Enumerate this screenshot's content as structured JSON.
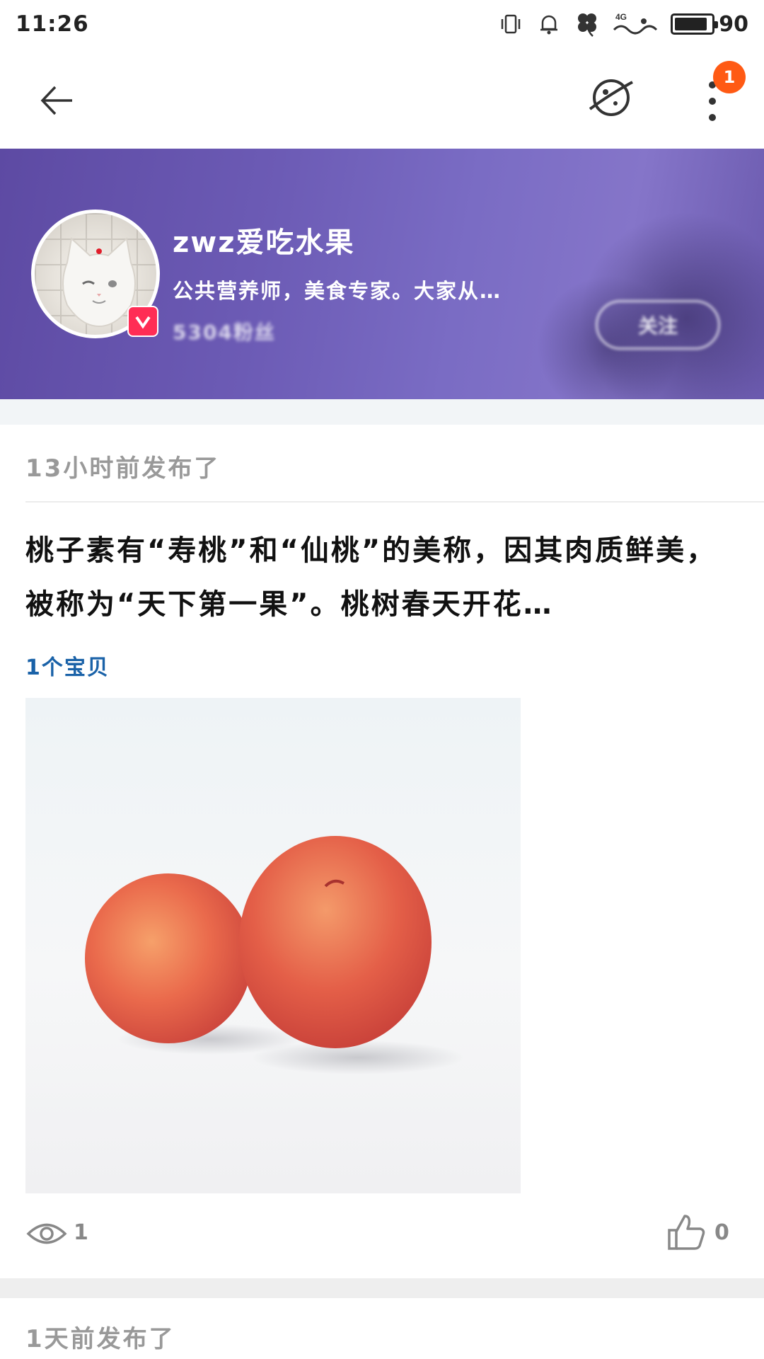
{
  "status_bar": {
    "time": "11:26",
    "network_label": "4G",
    "battery_level": "90"
  },
  "app_bar": {
    "notification_count": "1"
  },
  "profile": {
    "username": "zwz爱吃水果",
    "bio": "公共营养师，美食专家。大家从…",
    "verified": true
  },
  "posts": [
    {
      "time": "13小时前发布了",
      "text": "桃子素有“寿桃”和“仙桃”的美称，因其肉质鲜美，被称为“天下第一果”。桃树春天开花…",
      "item_count": "1个宝贝",
      "views": "1",
      "likes": "0"
    },
    {
      "time": "1天前发布了"
    }
  ],
  "colors": {
    "banner_start": "#5d4aa3",
    "banner_end": "#8575c9",
    "badge": "#ff5a14",
    "verified": "#ff2d55",
    "link": "#1a62a8"
  }
}
